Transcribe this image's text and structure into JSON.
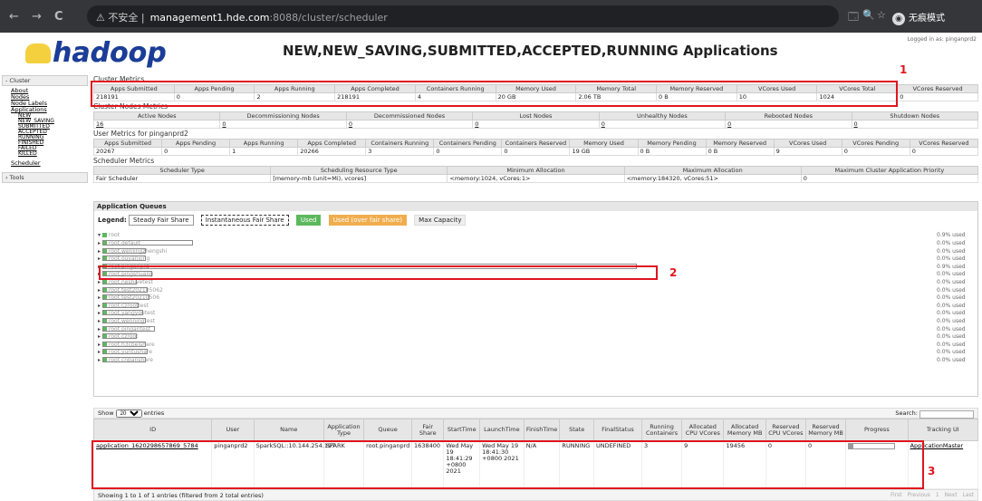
{
  "browser": {
    "warning": "不安全",
    "host": "management1.hde.com",
    "path": ":8088/cluster/scheduler",
    "incognito": "无痕模式",
    "back": "←",
    "forward": "→",
    "reload": "C",
    "translate": "🗔",
    "zoom": "🔍",
    "star": "☆"
  },
  "header": {
    "logo_text": "hadoop",
    "title": "NEW,NEW_SAVING,SUBMITTED,ACCEPTED,RUNNING Applications",
    "logged_in": "Logged in as: pinganprd2"
  },
  "sidebar": {
    "cluster_label": "- Cluster",
    "tools_label": "› Tools",
    "scheduler": "Scheduler",
    "items": [
      "About",
      "Nodes",
      "Node Labels",
      "Applications"
    ],
    "app_states": [
      "NEW",
      "NEW_SAVING",
      "SUBMITTED",
      "ACCEPTED",
      "RUNNING",
      "FINISHED",
      "FAILED",
      "KILLED"
    ]
  },
  "cluster_metrics": {
    "title": "Cluster Metrics",
    "headers": [
      "Apps Submitted",
      "Apps Pending",
      "Apps Running",
      "Apps Completed",
      "Containers Running",
      "Memory Used",
      "Memory Total",
      "Memory Reserved",
      "VCores Used",
      "VCores Total",
      "VCores Reserved"
    ],
    "values": [
      "218191",
      "0",
      "2",
      "218191",
      "4",
      "20 GB",
      "2.06 TB",
      "0 B",
      "10",
      "1024",
      "0"
    ]
  },
  "node_metrics": {
    "title": "Cluster Nodes Metrics",
    "headers": [
      "Active Nodes",
      "Decommissioning Nodes",
      "Decommissioned Nodes",
      "Lost Nodes",
      "Unhealthy Nodes",
      "Rebooted Nodes",
      "Shutdown Nodes"
    ],
    "values": [
      "16",
      "0",
      "0",
      "0",
      "0",
      "0",
      "0"
    ]
  },
  "user_metrics": {
    "title": "User Metrics for pinganprd2",
    "headers": [
      "Apps Submitted",
      "Apps Pending",
      "Apps Running",
      "Apps Completed",
      "Containers Running",
      "Containers Pending",
      "Containers Reserved",
      "Memory Used",
      "Memory Pending",
      "Memory Reserved",
      "VCores Used",
      "VCores Pending",
      "VCores Reserved"
    ],
    "values": [
      "20267",
      "0",
      "1",
      "20266",
      "3",
      "0",
      "0",
      "19 GB",
      "0 B",
      "0 B",
      "9",
      "0",
      "0"
    ]
  },
  "scheduler_metrics": {
    "title": "Scheduler Metrics",
    "headers": [
      "Scheduler Type",
      "Scheduling Resource Type",
      "Minimum Allocation",
      "Maximum Allocation",
      "Maximum Cluster Application Priority"
    ],
    "values": [
      "Fair Scheduler",
      "[memory-mb (unit=Mi), vcores]",
      "<memory:1024, vCores:1>",
      "<memory:184320, vCores:51>",
      "0"
    ]
  },
  "queues": {
    "title": "Application Queues",
    "legend_label": "Legend:",
    "legend": [
      "Steady Fair Share",
      "Instantaneous Fair Share",
      "Used",
      "Used (over fair share)",
      "Max Capacity"
    ],
    "root": "root",
    "root_used": "0.9% used",
    "items": [
      {
        "name": "root.default",
        "used": "0.0% used"
      },
      {
        "name": "root.wenlingzhengshi",
        "used": "0.0% used"
      },
      {
        "name": "root.ouyanxing",
        "used": "0.0% used"
      },
      {
        "name": "root.pinganprd",
        "used": "0.9% used"
      },
      {
        "name": "root.pingshuang",
        "used": "0.0% used"
      },
      {
        "name": "root.neshivetest",
        "used": "0.0% used"
      },
      {
        "name": "root.test202105062",
        "used": "0.0% used"
      },
      {
        "name": "root.test20210506",
        "used": "0.0% used"
      },
      {
        "name": "root.czroottest",
        "used": "0.0% used"
      },
      {
        "name": "root.yangyoutest",
        "used": "0.0% used"
      },
      {
        "name": "root.wenningtest",
        "used": "0.0% used"
      },
      {
        "name": "root.pingantest",
        "used": "0.0% used"
      },
      {
        "name": "root.czroot",
        "used": "0.0% used"
      },
      {
        "name": "root.h3cbelshare",
        "used": "0.0% used"
      },
      {
        "name": "root.yuntushare",
        "used": "0.0% used"
      },
      {
        "name": "root.cnbanshare",
        "used": "0.0% used"
      }
    ]
  },
  "apps": {
    "show_label": "Show",
    "show_value": "20",
    "entries_label": "entries",
    "search_label": "Search:",
    "headers": [
      "ID",
      "User",
      "Name",
      "Application Type",
      "Queue",
      "Fair Share",
      "StartTime",
      "LaunchTime",
      "FinishTime",
      "State",
      "FinalStatus",
      "Running Containers",
      "Allocated CPU VCores",
      "Allocated Memory MB",
      "Reserved CPU VCores",
      "Reserved Memory MB",
      "Progress",
      "Tracking UI"
    ],
    "row": {
      "id": "application_1620298657869_5784",
      "user": "pinganprd2",
      "name": "SparkSQL::10.144.254.197",
      "type": "SPARK",
      "queue": "root.pinganprd",
      "fair_share": "1638400",
      "start": "Wed May 19 18:41:29 +0800 2021",
      "launch": "Wed May 19 18:41:30 +0800 2021",
      "finish": "N/A",
      "state": "RUNNING",
      "final": "UNDEFINED",
      "containers": "3",
      "cpu": "9",
      "mem": "19456",
      "rcpu": "0",
      "rmem": "0",
      "progress": 0.1,
      "tracking": "ApplicationMaster"
    },
    "footer": "Showing 1 to 1 of 1 entries (filtered from 2 total entries)",
    "pager": [
      "First",
      "Previous",
      "1",
      "Next",
      "Last"
    ]
  },
  "annotations": [
    "1",
    "2",
    "3"
  ]
}
